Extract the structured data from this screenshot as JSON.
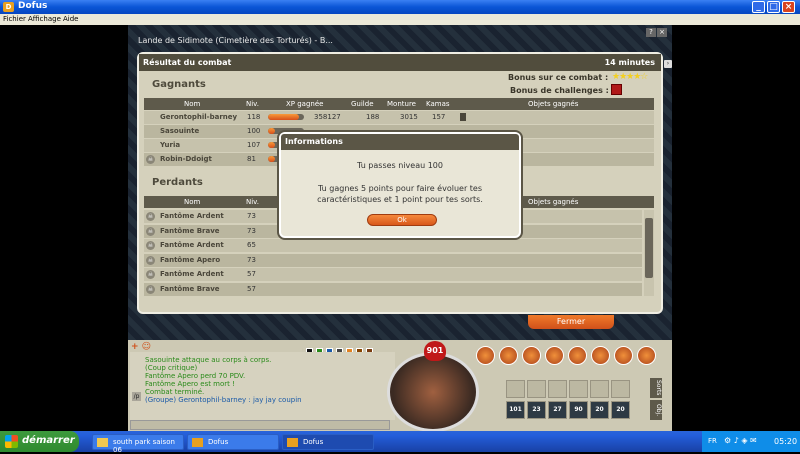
{
  "window": {
    "title": "Dofus",
    "minimize": "_",
    "maximize": "□",
    "close": "×"
  },
  "menu": [
    "Fichier",
    "Affichage",
    "Aide"
  ],
  "map_title": "Lande de Sidimote (Cimetière des Torturés) - B...",
  "panel": {
    "title": "Résultat du combat",
    "duration": "14 minutes",
    "winners_label": "Gagnants",
    "losers_label": "Perdants",
    "bonus_combat_label": "Bonus sur ce combat :",
    "bonus_challenges_label": "Bonus de challenges :",
    "close_label": "Fermer"
  },
  "winners_headers": [
    "Nom",
    "Niv.",
    "XP gagnée",
    "Guilde",
    "Monture",
    "Kamas",
    "Objets gagnés"
  ],
  "winners": [
    {
      "name": "Gerontophil-barney",
      "level": "118",
      "xp": "358127",
      "xp_fill": 0.85,
      "guild": "188",
      "mount": "3015",
      "kamas": "157"
    },
    {
      "name": "Sasouinte",
      "level": "100",
      "xp": "",
      "xp_fill": 0.2,
      "guild": "",
      "mount": "",
      "kamas": ""
    },
    {
      "name": "Yuria",
      "level": "107",
      "xp": "",
      "xp_fill": 0.2,
      "guild": "",
      "mount": "",
      "kamas": ""
    },
    {
      "name": "Robin-Ddoigt",
      "level": "81",
      "xp": "",
      "xp_fill": 0.2,
      "guild": "",
      "mount": "",
      "kamas": ""
    }
  ],
  "losers_headers": [
    "Nom",
    "Niv.",
    "Objets gagnés"
  ],
  "losers": [
    {
      "name": "Fantôme Ardent",
      "level": "73"
    },
    {
      "name": "Fantôme Brave",
      "level": "73"
    },
    {
      "name": "Fantôme Ardent",
      "level": "65"
    },
    {
      "name": "Fantôme Apero",
      "level": "73"
    },
    {
      "name": "Fantôme Ardent",
      "level": "57"
    },
    {
      "name": "Fantôme Brave",
      "level": "57"
    }
  ],
  "dialog": {
    "title": "Informations",
    "line1": "Tu passes niveau 100",
    "line2": "Tu gagnes 5 points pour faire évoluer tes",
    "line3": "caractéristiques et 1 point pour tes sorts.",
    "ok": "Ok"
  },
  "chat": [
    {
      "text": "Sasouinte attaque au corps à corps.",
      "color": "#2a8a1a"
    },
    {
      "text": "(Coup critique)",
      "color": "#2a8a1a"
    },
    {
      "text": "Fantôme Apero perd 70 PDV.",
      "color": "#2a8a1a"
    },
    {
      "text": "Fantôme Apero est mort !",
      "color": "#2a8a1a"
    },
    {
      "text": "Combat terminé.",
      "color": "#2a8a1a"
    },
    {
      "text": "(Groupe) Gerontophil-barney : jay jay coupin",
      "color": "#1a5aa8"
    }
  ],
  "hud": {
    "hp": "901",
    "slot_counts": [
      "101",
      "23",
      "27",
      "90",
      "20",
      "20"
    ],
    "side_labels": [
      "Sorts",
      "Obj."
    ]
  },
  "taskbar": {
    "start": "démarrer",
    "tasks": [
      "south park saison 06",
      "Dofus",
      "Dofus"
    ],
    "lang": "FR",
    "time": "05:20"
  },
  "colors": {
    "accent_orange": "#e06a22",
    "panel_bg": "#d5d1bc",
    "header_dark": "#514d3d"
  }
}
